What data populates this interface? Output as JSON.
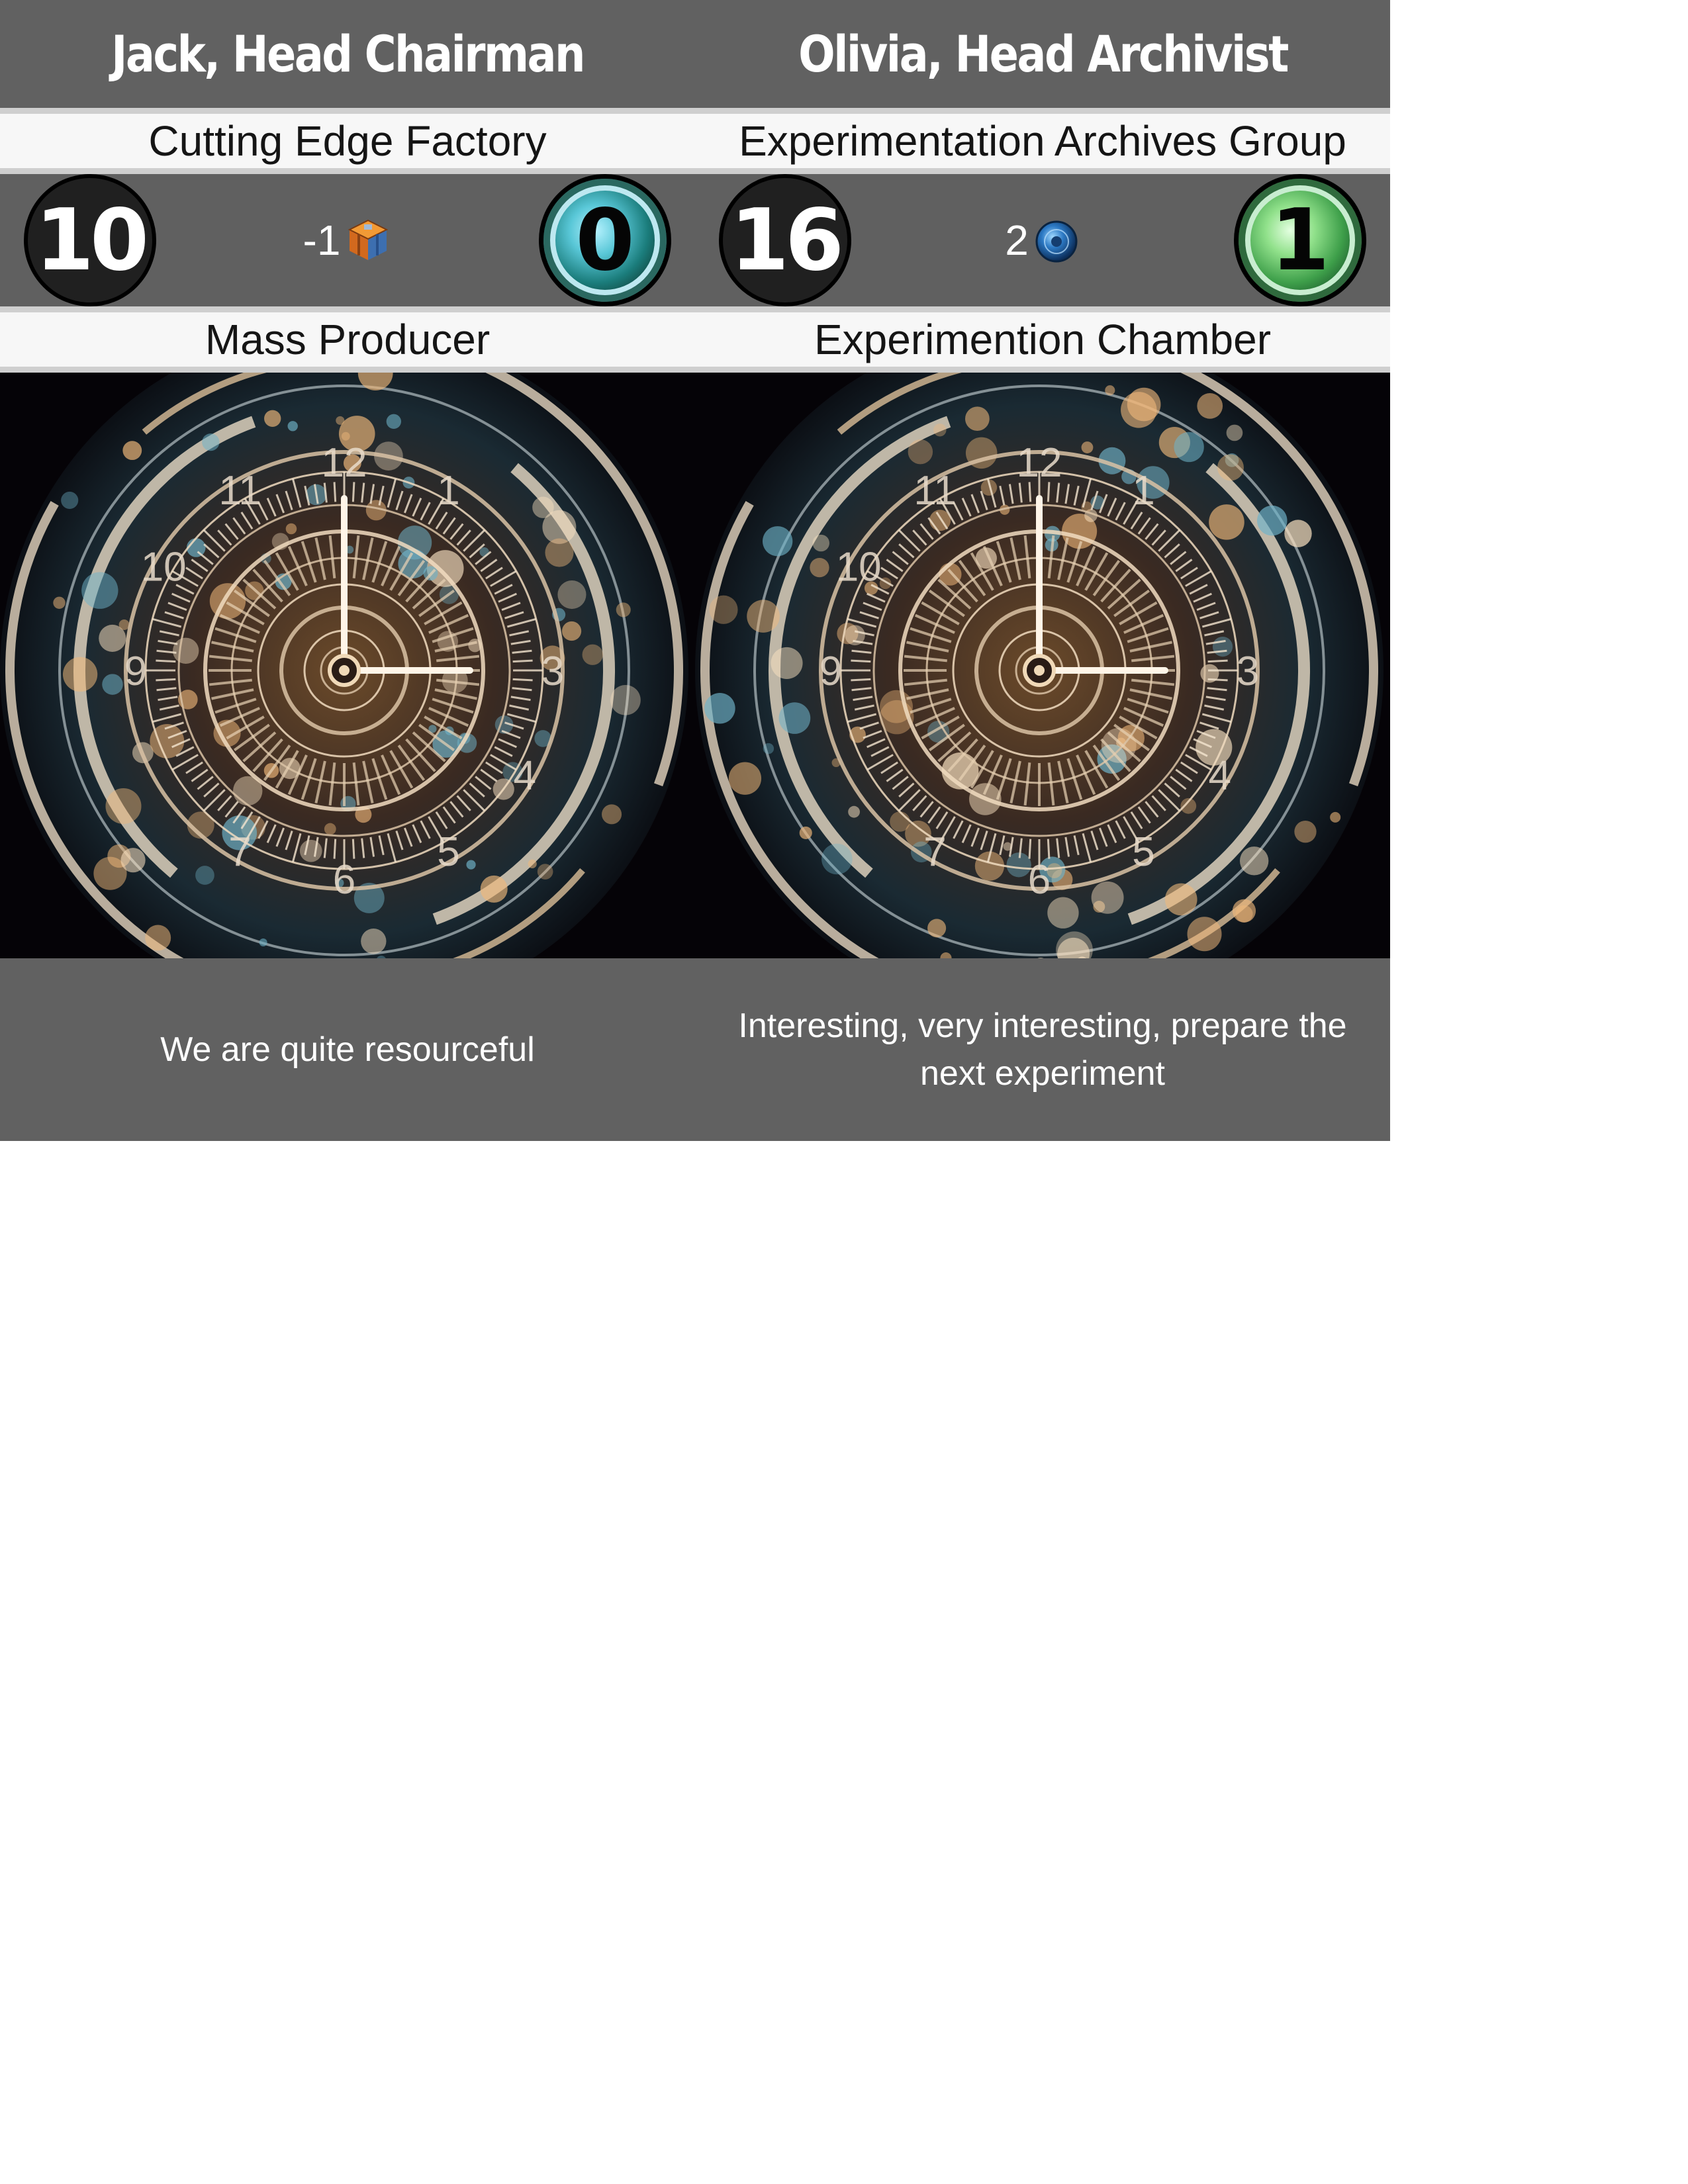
{
  "cards": [
    {
      "name": "Jack, Head Chairman",
      "faction": "Cutting Edge Factory",
      "cost": "10",
      "income": "-1",
      "income_icon": "crate-icon",
      "power": "0",
      "power_color": "#58c8d6",
      "ability": "Mass Producer",
      "flavor": "We are quite resourceful"
    },
    {
      "name": "Olivia, Head Archivist",
      "faction": "Experimentation Archives Group",
      "cost": "16",
      "income": "2",
      "income_icon": "orb-icon",
      "power": "1",
      "power_color": "#8fe088",
      "ability": "Experimention Chamber",
      "flavor": "Interesting, very interesting, prepare the next experiment"
    }
  ],
  "art": {
    "clock_numerals": [
      "12",
      "1",
      "3",
      "4",
      "5",
      "6",
      "7",
      "9",
      "10",
      "11"
    ]
  }
}
